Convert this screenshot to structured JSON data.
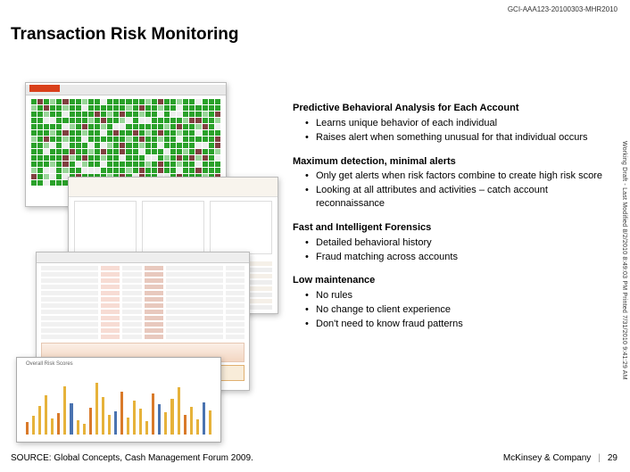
{
  "doc_id": "GCI-AAA123-20100303-MHR2010",
  "title": "Transaction Risk Monitoring",
  "vertical_note": "Working Draft - Last Modified 8/2/2010 8:49:03 PM   Printed 7/31/2010 9:41:29 AM",
  "sections": [
    {
      "heading": "Predictive Behavioral Analysis for Each Account",
      "bullets": [
        "Learns unique behavior of each individual",
        "Raises alert when something unusual for that individual occurs"
      ]
    },
    {
      "heading": "Maximum detection, minimal alerts",
      "bullets": [
        "Only get alerts when risk factors combine to create high risk score",
        "Looking at all attributes and activities – catch account reconnaissance"
      ]
    },
    {
      "heading": "Fast and Intelligent Forensics",
      "bullets": [
        "Detailed behavioral history",
        "Fraud matching across accounts"
      ]
    },
    {
      "heading": "Low maintenance",
      "bullets": [
        "No rules",
        "No change to client experience",
        "Don't need to know fraud patterns"
      ]
    }
  ],
  "chart_data": {
    "type": "bar",
    "title": "Overall Risk Scores",
    "values": [
      18,
      26,
      40,
      55,
      22,
      30,
      68,
      44,
      20,
      15,
      38,
      72,
      52,
      28,
      33,
      60,
      24,
      47,
      36,
      19,
      58,
      42,
      31,
      50,
      66,
      27,
      39,
      21,
      45,
      34
    ],
    "ylim": [
      0,
      80
    ]
  },
  "footer": {
    "source": "SOURCE: Global Concepts, Cash Management Forum 2009.",
    "company": "McKinsey & Company",
    "page": "29"
  }
}
